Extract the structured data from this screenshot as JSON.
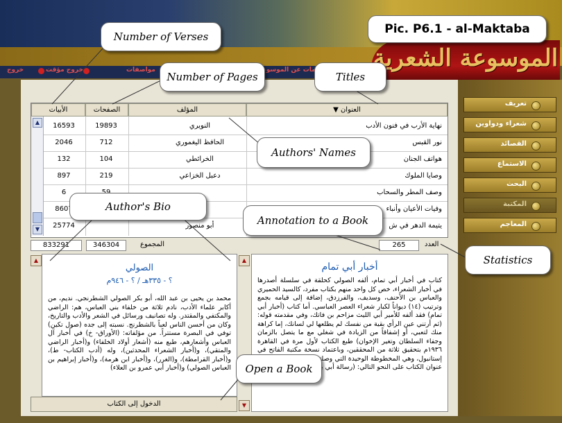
{
  "app": {
    "logo_text": "الموسوعة الشعرية"
  },
  "menubar": {
    "items": [
      "خروج",
      "خروج مؤقت",
      "مواصفات",
      "معلومات عن الموسوعة"
    ]
  },
  "sidebar": {
    "items": [
      {
        "label": "تعريف",
        "active": false
      },
      {
        "label": "شعراء ودواوين",
        "active": false
      },
      {
        "label": "القصائد",
        "active": false
      },
      {
        "label": "الاستماع",
        "active": false
      },
      {
        "label": "البحث",
        "active": false
      },
      {
        "label": "المكتبة",
        "active": true
      },
      {
        "label": "المعاجم",
        "active": false
      }
    ]
  },
  "table": {
    "headers": {
      "title": "العنوان",
      "author": "المؤلف",
      "pages": "الصفحات",
      "verses": "الأبيات"
    },
    "rows": [
      {
        "title": "نهاية الأرب في فنون الأدب",
        "author": "النويري",
        "pages": "19893",
        "verses": "16593"
      },
      {
        "title": "نور القبس",
        "author": "الحافظ اليغموري",
        "pages": "712",
        "verses": "2046"
      },
      {
        "title": "هواتف الجنان",
        "author": "الخرائطي",
        "pages": "104",
        "verses": "132"
      },
      {
        "title": "وصايا الملوك",
        "author": "دعبل الخزاعي",
        "pages": "219",
        "verses": "897"
      },
      {
        "title": "وصف المطر والسحاب",
        "author": "",
        "pages": "59",
        "verses": "6"
      },
      {
        "title": "وفيات الأعيان وأنباء",
        "author": "",
        "pages": "",
        "verses": "8607"
      },
      {
        "title": "يتيمة الدهر في ش",
        "author": "أبو منصور",
        "pages": "",
        "verses": "25774"
      }
    ],
    "totals": {
      "label_total": "المجموع",
      "pages": "346304",
      "verses": "833291",
      "label_count": "العدد",
      "count": "265"
    }
  },
  "book_panel": {
    "title": "أخبار أبي تمام",
    "text": "كتاب في أخبار أبي تمام، ألفه الصولي كحلقة في سلسلة أصدرها في أخبار الشعراء، خص كل واحد منهم بكتاب مفرد، كالسيد الحميري والعباس بن الأحنف، وسديف، والفرزدق، إضافة إلى قيامه بجمع وترتيب (١٤) ديواناً لكبار شعراء العصر العباسي. أما كتاب (أخبار أبي تمام) فقد ألفه للأمير أبي الليث مزاحم بن فاتك، وفي مقدمته قوله: (ثم أرتني عين الرأي بقية من نفسك لم يطلعها لي لسانك، إما كراهة منك لتعبي، أو إشفاقاً من الزيادة في شغلي مع ما يتصل بالزمان وجفاء السلطان وتغير الإخوان) طبع الكتاب لأول مرة في القاهرة ١٩٣٦م بتحقيق ثلاثة من المحققين، وباعتماد نسخة مكتبة الفاتح في إستانبول، وهي المخطوطة الوحيدة التي وصلتنا لهذا الكتاب، جاء فيها عنوان الكتاب على النحو التالي: (رسالة أبي بكر الصولي إلى أبي"
  },
  "author_panel": {
    "name": "الصولي",
    "dates": "؟ - ٣٣٥هـ / ؟ - ٩٤٦م",
    "text": "محمد بن يحيى بن عبد الله، أبو بكر الصولي الشطرنجي. نديم، من أكابر علماء الأدب، نادم ثلاثة من خلفاء بني العباس، هم: الراضي والمكتفي والمقتدر. وله تصانيف ورسائل في الشعر والأدب والتاريخ، وكان من أحسن الناس لعباً بالشطرنج. نسبته إلى جده (صول تكين) توفي في البصرة مستتراً. من مؤلفاته: (الأوراق- خ) في أخبار آل العباس وأشعارهم، طبع منه (أشعار أولاد الخلفاء) و(أخبار الراضي والمتقي)، و(أخبار الشعراء المحدثين)، وله (أدب الكتاب- ط)، و(أخبار القرامطة)، و(الغرر)، و(أخبار ابن هرمة)، و(أخبار إبراهيم بن العباس الصولي) و(أخبار أبي عمرو بن العلاء)"
  },
  "enter_button": {
    "label": "الدخول إلى الكتاب"
  },
  "callouts": {
    "pic_label": "Pic. P6.1 - al-Maktaba",
    "verses": "Number of Verses",
    "pages": "Number of Pages",
    "titles": "Titles",
    "authors": "Authors' Names",
    "bio": "Author's Bio",
    "annotation": "Annotation to a Book",
    "statistics": "Statistics",
    "open": "Open a Book"
  }
}
